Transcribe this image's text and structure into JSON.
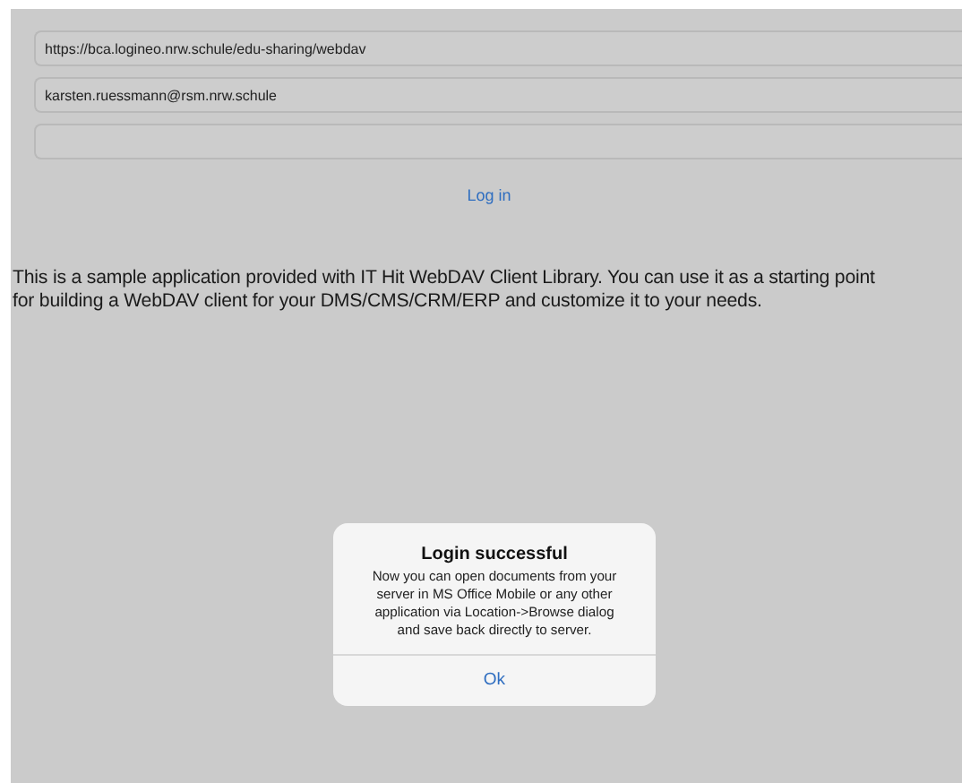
{
  "login_form": {
    "fields": [
      {
        "value": "https://bca.logineo.nrw.schule/edu-sharing/webdav"
      },
      {
        "value": "karsten.ruessmann@rsm.nrw.schule"
      }
    ],
    "login_button": "Log in"
  },
  "description": "This is a sample application provided with IT Hit WebDAV Client Library. You can use it as a starting point for building a WebDAV client for your DMS/CMS/CRM/ERP and customize it to your needs.",
  "alert": {
    "title": "Login successful",
    "message": "Now you can open documents from your server in MS Office Mobile or any other application via Location->Browse dialog and save back directly to server.",
    "button": "Ok"
  }
}
